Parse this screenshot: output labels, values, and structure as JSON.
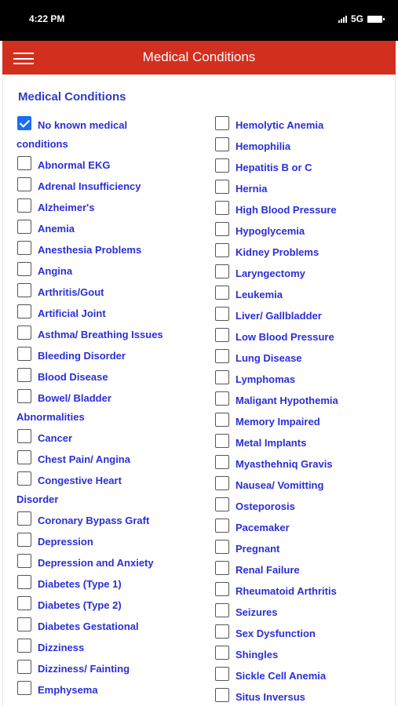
{
  "status_bar": {
    "time": "4:22 PM",
    "network": "5G"
  },
  "header": {
    "title": "Medical Conditions",
    "menu_icon": "hamburger-menu-icon",
    "color": "#d32f1e"
  },
  "section": {
    "title": "Medical Conditions"
  },
  "conditions_left": [
    {
      "label": "No known medical",
      "cont": "conditions",
      "checked": true
    },
    {
      "label": "Abnormal EKG",
      "checked": false
    },
    {
      "label": "Adrenal Insufficiency",
      "checked": false
    },
    {
      "label": "Alzheimer's",
      "checked": false
    },
    {
      "label": "Anemia",
      "checked": false
    },
    {
      "label": "Anesthesia Problems",
      "checked": false
    },
    {
      "label": "Angina",
      "checked": false
    },
    {
      "label": "Arthritis/Gout",
      "checked": false
    },
    {
      "label": "Artificial Joint",
      "checked": false
    },
    {
      "label": "Asthma/ Breathing Issues",
      "checked": false
    },
    {
      "label": "Bleeding Disorder",
      "checked": false
    },
    {
      "label": "Blood Disease",
      "checked": false
    },
    {
      "label": "Bowel/ Bladder",
      "cont": "Abnormalities",
      "checked": false
    },
    {
      "label": "Cancer",
      "checked": false
    },
    {
      "label": "Chest Pain/ Angina",
      "checked": false
    },
    {
      "label": "Congestive Heart",
      "cont": "Disorder",
      "checked": false
    },
    {
      "label": "Coronary Bypass Graft",
      "checked": false
    },
    {
      "label": "Depression",
      "checked": false
    },
    {
      "label": "Depression and Anxiety",
      "checked": false
    },
    {
      "label": "Diabetes (Type 1)",
      "checked": false
    },
    {
      "label": "Diabetes (Type 2)",
      "checked": false
    },
    {
      "label": "Diabetes Gestational",
      "checked": false
    },
    {
      "label": "Dizziness",
      "checked": false
    },
    {
      "label": "Dizziness/ Fainting",
      "checked": false
    },
    {
      "label": "Emphysema",
      "checked": false
    }
  ],
  "conditions_right": [
    {
      "label": "Hemolytic Anemia",
      "checked": false
    },
    {
      "label": "Hemophilia",
      "checked": false
    },
    {
      "label": "Hepatitis B or C",
      "checked": false
    },
    {
      "label": "Hernia",
      "checked": false
    },
    {
      "label": "High Blood Pressure",
      "checked": false
    },
    {
      "label": "Hypoglycemia",
      "checked": false
    },
    {
      "label": "Kidney Problems",
      "checked": false
    },
    {
      "label": "Laryngectomy",
      "checked": false
    },
    {
      "label": "Leukemia",
      "checked": false
    },
    {
      "label": "Liver/ Gallbladder",
      "checked": false
    },
    {
      "label": "Low Blood Pressure",
      "checked": false
    },
    {
      "label": "Lung Disease",
      "checked": false
    },
    {
      "label": "Lymphomas",
      "checked": false
    },
    {
      "label": "Maligant Hypothemia",
      "checked": false
    },
    {
      "label": "Memory Impaired",
      "checked": false
    },
    {
      "label": "Metal Implants",
      "checked": false
    },
    {
      "label": "Myasthehniq Gravis",
      "checked": false
    },
    {
      "label": "Nausea/ Vomitting",
      "checked": false
    },
    {
      "label": "Osteporosis",
      "checked": false
    },
    {
      "label": "Pacemaker",
      "checked": false
    },
    {
      "label": "Pregnant",
      "checked": false
    },
    {
      "label": "Renal Failure",
      "checked": false
    },
    {
      "label": "Rheumatoid Arthritis",
      "checked": false
    },
    {
      "label": "Seizures",
      "checked": false
    },
    {
      "label": "Sex Dysfunction",
      "checked": false
    },
    {
      "label": "Shingles",
      "checked": false
    },
    {
      "label": "Sickle Cell Anemia",
      "checked": false
    },
    {
      "label": "Situs Inversus",
      "checked": false
    }
  ]
}
